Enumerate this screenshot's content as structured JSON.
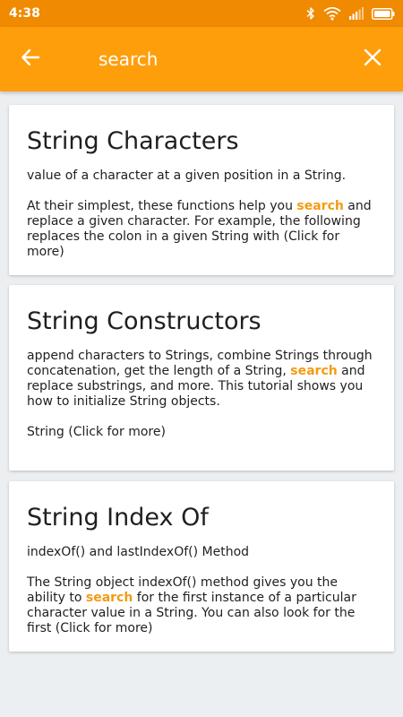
{
  "status_bar": {
    "time": "4:38",
    "icons": [
      "bluetooth-icon",
      "wifi-icon",
      "signal-icon",
      "battery-icon"
    ],
    "color": "#f08a00"
  },
  "toolbar": {
    "search_value": "search",
    "back_icon": "arrow-left-icon",
    "close_icon": "close-icon",
    "color": "#ff9e0b"
  },
  "results": [
    {
      "title": "String Characters",
      "p1": "value of a character at a given position in a String.",
      "p2_before": "At their simplest, these functions help you ",
      "p2_highlight": "search",
      "p2_after": " and replace a given character. For example, the following replaces the colon in a given String with (Click for more)"
    },
    {
      "title": "String Constructors",
      "p1_before": "append characters to Strings, combine Strings through concatenation, get the length of a String, ",
      "p1_highlight": "search",
      "p1_after": " and replace substrings, and more. This tutorial shows you how to initialize String objects.",
      "p2": "String (Click for more)"
    },
    {
      "title": "String Index Of",
      "p1": "indexOf() and lastIndexOf() Method",
      "p2_before": "The String object indexOf() method gives you the ability to ",
      "p2_highlight": "search",
      "p2_after": " for the first instance of a particular character value in a String. You can also look for the first (Click for more)"
    }
  ],
  "highlight_color": "#f39b12",
  "background_color": "#eceff1"
}
